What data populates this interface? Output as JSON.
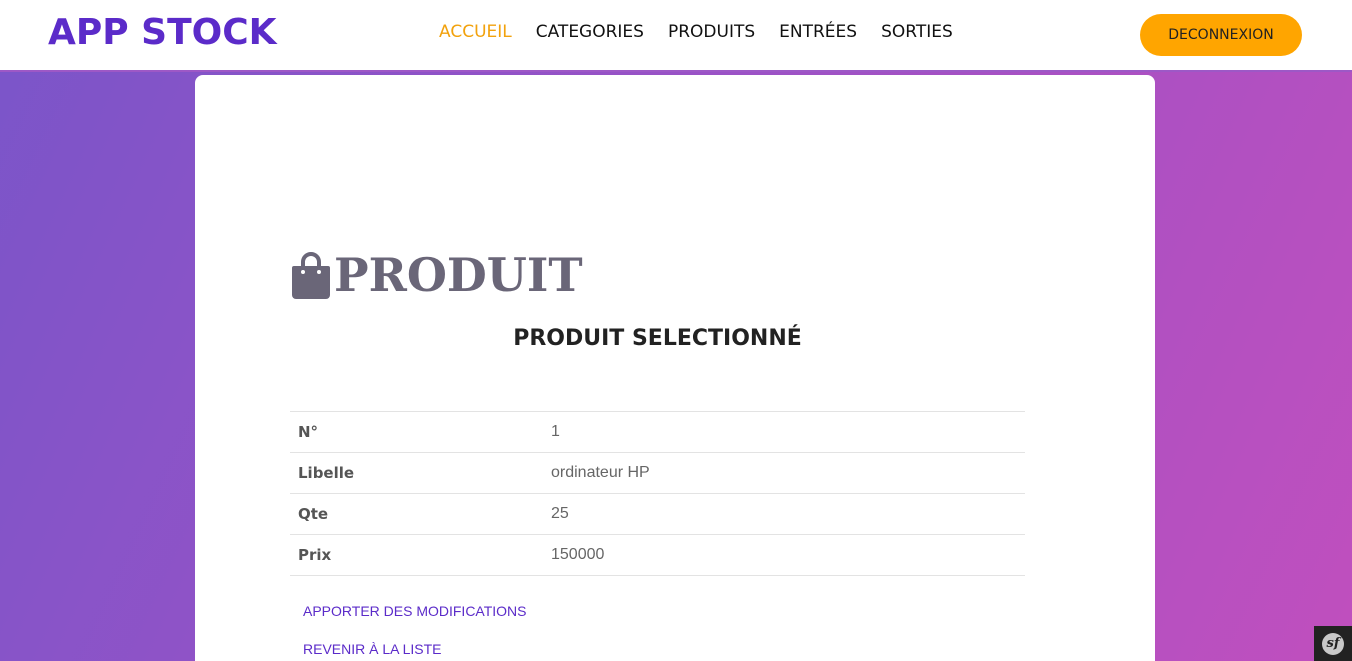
{
  "brand": "APP STOCK",
  "nav": {
    "items": [
      {
        "label": "ACCUEIL",
        "active": true
      },
      {
        "label": "CATEGORIES",
        "active": false
      },
      {
        "label": "PRODUITS",
        "active": false
      },
      {
        "label": "ENTRÉES",
        "active": false
      },
      {
        "label": "SORTIES",
        "active": false
      }
    ],
    "logout_label": "DECONNEXION"
  },
  "page": {
    "title": "PRODUIT",
    "title_icon": "shopping-bag-icon",
    "subtitle": "PRODUIT SELECTIONNÉ"
  },
  "details": {
    "rows": [
      {
        "label": "N°",
        "value": "1"
      },
      {
        "label": "Libelle",
        "value": "ordinateur HP"
      },
      {
        "label": "Qte",
        "value": "25"
      },
      {
        "label": "Prix",
        "value": "150000"
      }
    ]
  },
  "actions": {
    "edit_label": "APPORTER DES MODIFICATIONS",
    "back_label": "REVENIR À LA LISTE"
  },
  "colors": {
    "brand": "#5b2bc9",
    "active_nav": "#f2a20d",
    "logout_button": "#ffa500"
  },
  "debug_toolbar": {
    "icon": "symfony-icon",
    "glyph": "sf"
  }
}
